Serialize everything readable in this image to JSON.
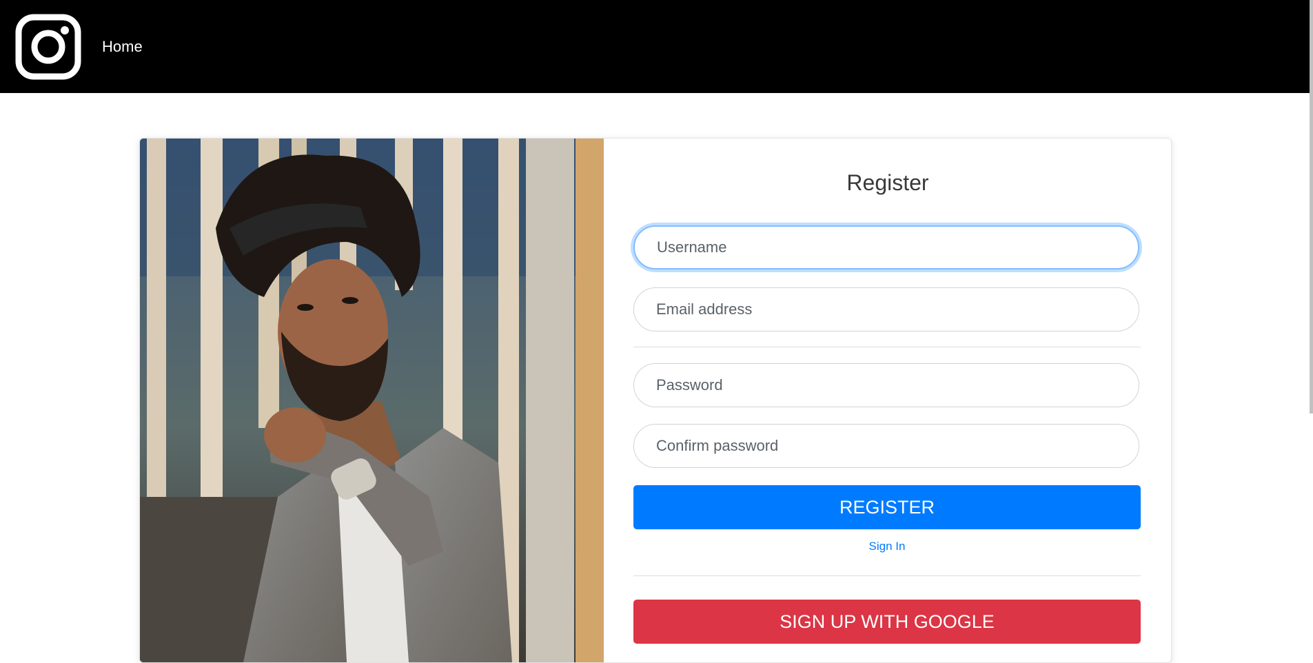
{
  "navbar": {
    "logo_icon": "instagram-icon",
    "home_label": "Home"
  },
  "register": {
    "title": "Register",
    "username_placeholder": "Username",
    "email_placeholder": "Email address",
    "password_placeholder": "Password",
    "confirm_placeholder": "Confirm password",
    "register_button": "REGISTER",
    "signin_link": "Sign In",
    "google_button": "SIGN UP WITH GOOGLE"
  },
  "colors": {
    "navbar_bg": "#000000",
    "primary": "#007bff",
    "danger": "#dc3545"
  }
}
